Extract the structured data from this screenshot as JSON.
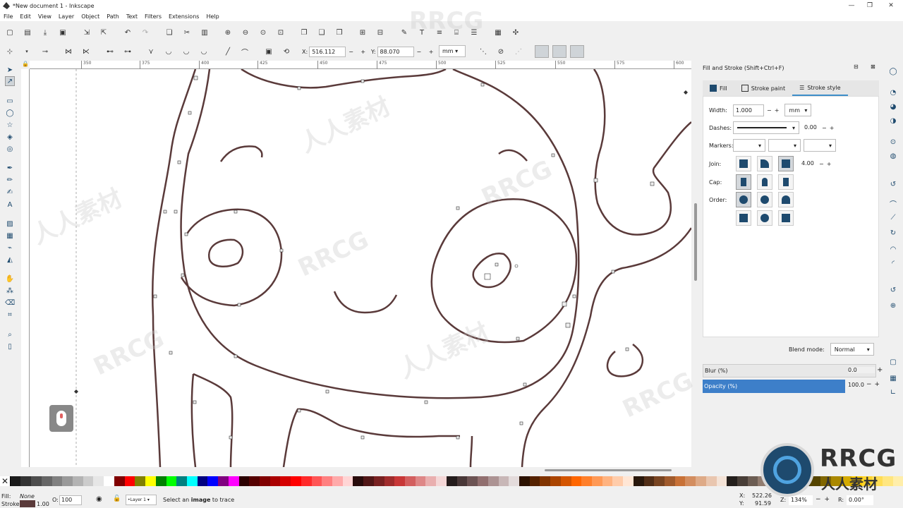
{
  "window": {
    "title": "*New document 1 - Inkscape"
  },
  "menu": [
    "File",
    "Edit",
    "View",
    "Layer",
    "Object",
    "Path",
    "Text",
    "Filters",
    "Extensions",
    "Help"
  ],
  "toolbar2": {
    "x_label": "X:",
    "x_value": "516.112",
    "y_label": "Y:",
    "y_value": "88.070",
    "unit": "mm"
  },
  "ruler": {
    "ticks": [
      "350",
      "375",
      "400",
      "425",
      "450",
      "475",
      "500",
      "525",
      "550",
      "575",
      "600"
    ]
  },
  "dialog": {
    "title": "Fill and Stroke (Shift+Ctrl+F)",
    "tabs": [
      "Fill",
      "Stroke paint",
      "Stroke style"
    ],
    "width_label": "Width:",
    "width_value": "1.000",
    "width_unit": "mm",
    "dashes_label": "Dashes:",
    "dashes_offset": "0.00",
    "markers_label": "Markers:",
    "join_label": "Join:",
    "miter_value": "4.00",
    "cap_label": "Cap:",
    "order_label": "Order:",
    "blend_label": "Blend mode:",
    "blend_value": "Normal",
    "blur_label": "Blur (%)",
    "blur_value": "0.0",
    "opacity_label": "Opacity (%)",
    "opacity_value": "100.0"
  },
  "status": {
    "fill_label": "Fill:",
    "fill_value": "None",
    "stroke_label": "Stroke:",
    "stroke_width": "1.00",
    "opacity_label": "O:",
    "opacity_value": "100",
    "layer": "•Layer 1",
    "message_pre": "Select an ",
    "message_bold": "image",
    "message_post": " to trace",
    "x_label": "X:",
    "x_value": "522.26",
    "y_label": "Y:",
    "y_value": "91.59",
    "z_label": "Z:",
    "zoom_value": "134%",
    "r_label": "R:",
    "rotation_value": "0.00°"
  },
  "watermark": {
    "text1": "RRCG",
    "text2": "人人素材"
  },
  "logo": {
    "title": "RRCG",
    "subtitle": "人人素材"
  },
  "colors": {
    "stroke": "#5a3a3a",
    "accent": "#3d7fc9",
    "tab_underline": "#3d8ec9"
  },
  "palette": [
    "#000000",
    "#1a1a1a",
    "#333333",
    "#4d4d4d",
    "#666666",
    "#808080",
    "#999999",
    "#b3b3b3",
    "#cccccc",
    "#e6e6e6",
    "#ffffff",
    "#800000",
    "#ff0000",
    "#808000",
    "#ffff00",
    "#008000",
    "#00ff00",
    "#008080",
    "#00ffff",
    "#000080",
    "#0000ff",
    "#800080",
    "#ff00ff",
    "#2b0000",
    "#550000",
    "#800000",
    "#aa0000",
    "#d40000",
    "#ff0000",
    "#ff2a2a",
    "#ff5555",
    "#ff8080",
    "#ffaaaa",
    "#ffd5d5",
    "#280b0b",
    "#501616",
    "#782121",
    "#a02c2c",
    "#c83737",
    "#d35f5f",
    "#de8787",
    "#e9afaf",
    "#f4d7d7",
    "#241c1c",
    "#483737",
    "#6c5353",
    "#916f6f",
    "#ac9393",
    "#c8b7b7",
    "#e3dbdb",
    "#2b1100",
    "#552200",
    "#803300",
    "#aa4400",
    "#d45500",
    "#ff6600",
    "#ff7f2a",
    "#ff9955",
    "#ffb380",
    "#ffccaa",
    "#ffe6d5",
    "#28170b",
    "#502d16",
    "#784421",
    "#a05a2c",
    "#c87137",
    "#d38d5f",
    "#deaa87",
    "#e9c6af",
    "#f4e3d7",
    "#241f1c",
    "#483e37",
    "#6c5d53",
    "#917c6f",
    "#ac9d93",
    "#c8beb7",
    "#e3dedb",
    "#2b2200",
    "#554400",
    "#806600",
    "#aa8800",
    "#d4aa00",
    "#ffcc00",
    "#ffd42a",
    "#ffdd55",
    "#ffe680",
    "#ffeeaa"
  ],
  "tools_left": [
    "select-arrow",
    "node-tool",
    "rect-tool",
    "ellipse-tool",
    "star-tool",
    "box3d-tool",
    "spiral-tool",
    "pen-tool",
    "pencil-tool",
    "calligraphy-tool",
    "text-tool",
    "gradient-tool",
    "mesh-tool",
    "dropper-tool",
    "paint-bucket-tool",
    "tweak-tool",
    "spray-tool",
    "eraser-tool",
    "connector-tool",
    "zoom-tool",
    "measure-tool"
  ]
}
